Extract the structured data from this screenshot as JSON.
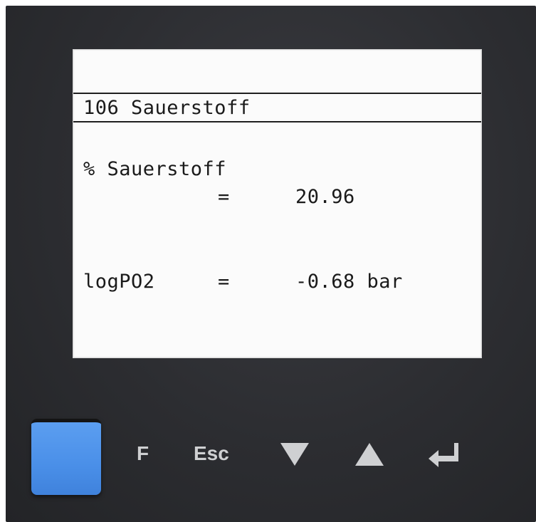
{
  "display": {
    "header": "106 Sauerstoff",
    "rows": [
      {
        "label": "% Sauerstoff",
        "equals": "=",
        "value": "20.96"
      },
      {
        "label": "logPO2",
        "equals": "=",
        "value": "-0.68 bar"
      }
    ]
  },
  "keypad": {
    "f_label": "F",
    "esc_label": "Esc",
    "blue_key_color": "#4a8fe8",
    "down_icon": "triangle-down-icon",
    "up_icon": "triangle-up-icon",
    "enter_icon": "enter-return-icon"
  }
}
